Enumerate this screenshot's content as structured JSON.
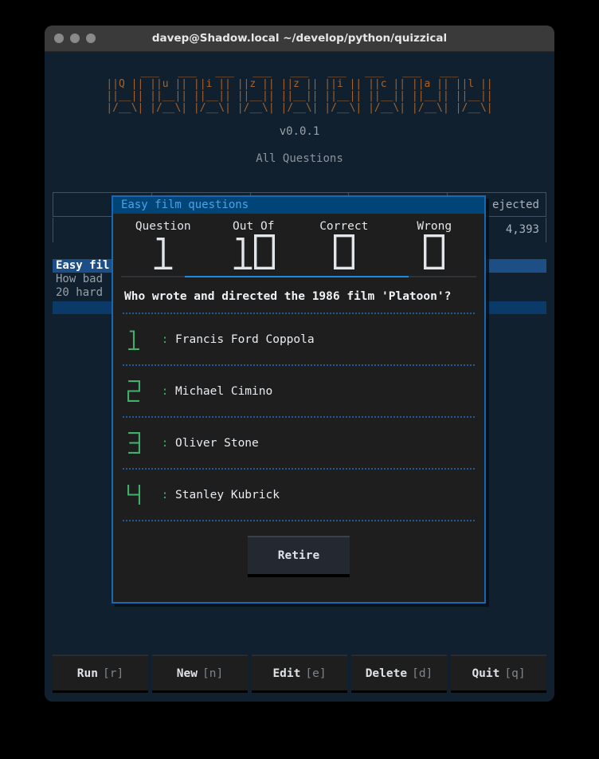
{
  "window": {
    "title": "davep@Shadow.local ~/develop/python/quizzical",
    "lights": [
      "close-dot",
      "minimize-dot",
      "zoom-dot"
    ]
  },
  "header": {
    "ascii_logo": " ___   ___   ___   ___   ___   ___   ___   ___   ___ \n||Q || ||u || ||i || ||z || ||z || ||i || ||c || ||a || ||l ||\n||__|| ||__|| ||__|| ||__|| ||__|| ||__|| ||__|| ||__|| ||__||\n|/__\\| |/__\\| |/__\\| |/__\\| |/__\\| |/__\\| |/__\\| |/__\\| |/__\\|",
    "version": "v0.0.1",
    "subtitle": "All Questions",
    "logo_color": "#a8622b"
  },
  "background_table": {
    "columns": [
      "",
      "",
      "",
      "",
      "ejected"
    ],
    "rows": [
      [
        "",
        "",
        "",
        "",
        "4,393"
      ]
    ]
  },
  "background_list": {
    "items": [
      {
        "label": "Easy fil",
        "selected": true
      },
      {
        "label": "How bad",
        "selected": false
      },
      {
        "label": "20 hard",
        "selected": false
      }
    ]
  },
  "footer": {
    "buttons": [
      {
        "label": "Run",
        "key": "[r]"
      },
      {
        "label": "New",
        "key": "[n]"
      },
      {
        "label": "Edit",
        "key": "[e]"
      },
      {
        "label": "Delete",
        "key": "[d]"
      },
      {
        "label": "Quit",
        "key": "[q]"
      }
    ]
  },
  "modal": {
    "title": "Easy film questions",
    "border_color": "#1769b5",
    "titlebar_color": "#004578",
    "stats": [
      {
        "label": "Question",
        "value": "1"
      },
      {
        "label": "Out Of",
        "value": "10"
      },
      {
        "label": "Correct",
        "value": "0"
      },
      {
        "label": "Wrong",
        "value": "0"
      }
    ],
    "question": "Who wrote and directed the 1986 film 'Platoon'?",
    "answers": [
      {
        "number": "1",
        "separator": ":",
        "text": "Francis Ford Coppola"
      },
      {
        "number": "2",
        "separator": ":",
        "text": "Michael Cimino"
      },
      {
        "number": "3",
        "separator": ":",
        "text": "Oliver Stone"
      },
      {
        "number": "4",
        "separator": ":",
        "text": "Stanley Kubrick"
      }
    ],
    "retire_label": "Retire",
    "answer_number_color": "#3fb26a",
    "stat_value_color": "#e2e6ea"
  }
}
